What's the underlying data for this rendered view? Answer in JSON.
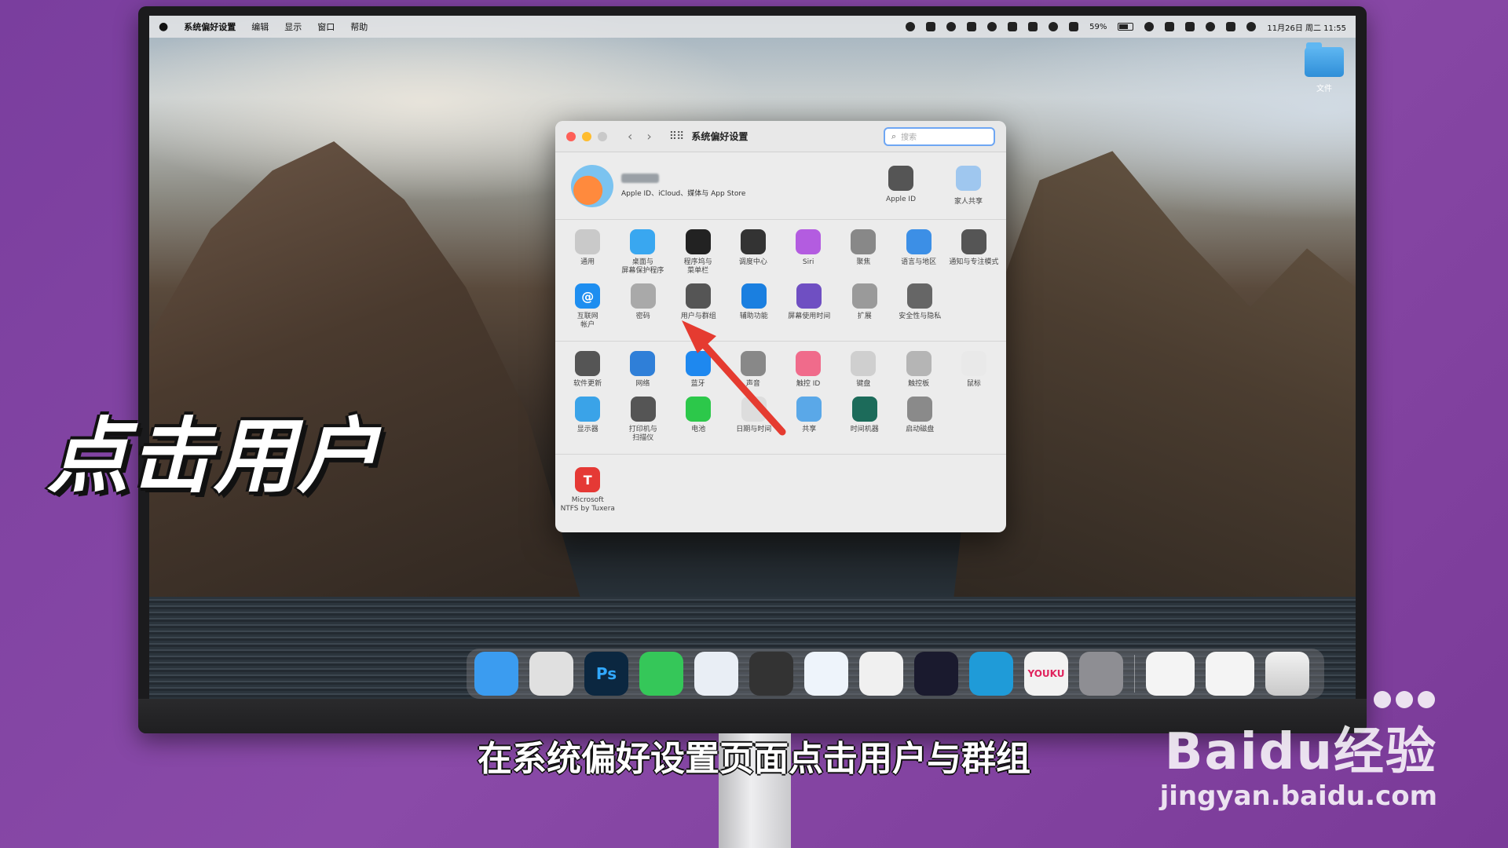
{
  "menubar": {
    "app": "系统偏好设置",
    "menus": [
      "编辑",
      "显示",
      "窗口",
      "帮助"
    ],
    "battery": "59%",
    "datetime": "11月26日 周二 11:55"
  },
  "desktop": {
    "folder_label": "文件"
  },
  "window": {
    "title": "系统偏好设置",
    "search_placeholder": "搜索",
    "account_subtitle": "Apple ID、iCloud、媒体与 App Store",
    "top_items": [
      {
        "label": "Apple ID",
        "color": "#555555"
      },
      {
        "label": "家人共享",
        "color": "#9fc7ef"
      }
    ],
    "rows": [
      [
        {
          "label": "通用",
          "color": "#c9c9c9",
          "icon": "general-icon"
        },
        {
          "label": "桌面与\n屏幕保护程序",
          "color": "#39a7f0",
          "icon": "desktop-icon"
        },
        {
          "label": "程序坞与\n菜单栏",
          "color": "#222222",
          "icon": "dock-icon"
        },
        {
          "label": "调度中心",
          "color": "#333333",
          "icon": "mission-control-icon"
        },
        {
          "label": "Siri",
          "color": "#b35ce0",
          "icon": "siri-icon"
        },
        {
          "label": "聚焦",
          "color": "#888888",
          "icon": "spotlight-icon"
        },
        {
          "label": "语言与地区",
          "color": "#3c8fe6",
          "icon": "language-icon"
        },
        {
          "label": "通知与专注模式",
          "color": "#555555",
          "icon": "bell-icon"
        }
      ],
      [
        {
          "label": "互联网\n帐户",
          "color": "#1e8ef0",
          "icon": "at-icon",
          "glyph": "@"
        },
        {
          "label": "密码",
          "color": "#a9a9a9",
          "icon": "key-icon"
        },
        {
          "label": "用户与群组",
          "color": "#555555",
          "icon": "users-icon"
        },
        {
          "label": "辅助功能",
          "color": "#1a7fe0",
          "icon": "accessibility-icon"
        },
        {
          "label": "屏幕使用时间",
          "color": "#6f4fc2",
          "icon": "hourglass-icon"
        },
        {
          "label": "扩展",
          "color": "#9a9a9a",
          "icon": "puzzle-icon"
        },
        {
          "label": "安全性与隐私",
          "color": "#666666",
          "icon": "house-icon"
        }
      ]
    ],
    "rows2": [
      [
        {
          "label": "软件更新",
          "color": "#555555",
          "icon": "gear-icon"
        },
        {
          "label": "网络",
          "color": "#2f7fd8",
          "icon": "globe-icon"
        },
        {
          "label": "蓝牙",
          "color": "#1e88ef",
          "icon": "bluetooth-icon"
        },
        {
          "label": "声音",
          "color": "#888888",
          "icon": "speaker-icon"
        },
        {
          "label": "触控 ID",
          "color": "#f06b8b",
          "icon": "fingerprint-icon"
        },
        {
          "label": "键盘",
          "color": "#cfcfcf",
          "icon": "keyboard-icon"
        },
        {
          "label": "触控板",
          "color": "#b5b5b5",
          "icon": "trackpad-icon"
        },
        {
          "label": "鼠标",
          "color": "#e9e9e9",
          "icon": "mouse-icon"
        }
      ],
      [
        {
          "label": "显示器",
          "color": "#3aa3e8",
          "icon": "display-icon"
        },
        {
          "label": "打印机与\n扫描仪",
          "color": "#555555",
          "icon": "printer-icon"
        },
        {
          "label": "电池",
          "color": "#2cc84a",
          "icon": "battery-icon"
        },
        {
          "label": "日期与时间",
          "color": "#dddddd",
          "icon": "clock-icon"
        },
        {
          "label": "共享",
          "color": "#5aa8e8",
          "icon": "folder-icon"
        },
        {
          "label": "时间机器",
          "color": "#1c6b5a",
          "icon": "time-machine-icon"
        },
        {
          "label": "启动磁盘",
          "color": "#8a8a8a",
          "icon": "disk-icon"
        }
      ]
    ],
    "third_party": [
      {
        "label": "Microsoft\nNTFS by Tuxera",
        "color": "#e53935",
        "icon": "tuxera-icon",
        "glyph": "T"
      }
    ]
  },
  "dock": [
    {
      "name": "finder",
      "color": "#3b9cf0",
      "glyph": ""
    },
    {
      "name": "launchpad",
      "color": "#e0e0e0",
      "glyph": ""
    },
    {
      "name": "photoshop",
      "color": "#0b2740",
      "glyph": "Ps"
    },
    {
      "name": "messages",
      "color": "#35c759",
      "glyph": ""
    },
    {
      "name": "safari",
      "color": "#e9eef5",
      "glyph": ""
    },
    {
      "name": "quicktime",
      "color": "#333333",
      "glyph": ""
    },
    {
      "name": "mail",
      "color": "#eef4fb",
      "glyph": ""
    },
    {
      "name": "qq",
      "color": "#f0f0f0",
      "glyph": ""
    },
    {
      "name": "video-player",
      "color": "#1a1a2e",
      "glyph": ""
    },
    {
      "name": "edge",
      "color": "#1f9bd8",
      "glyph": ""
    },
    {
      "name": "youku",
      "color": "#f2f2f2",
      "glyph": "YOUKU"
    },
    {
      "name": "system-preferences",
      "color": "#8e8e93",
      "glyph": ""
    }
  ],
  "overlay": {
    "headline": "点击用户",
    "subtitle": "在系统偏好设置页面点击用户与群组",
    "watermark_logo": "Baidu经验",
    "watermark_url": "jingyan.baidu.com"
  }
}
